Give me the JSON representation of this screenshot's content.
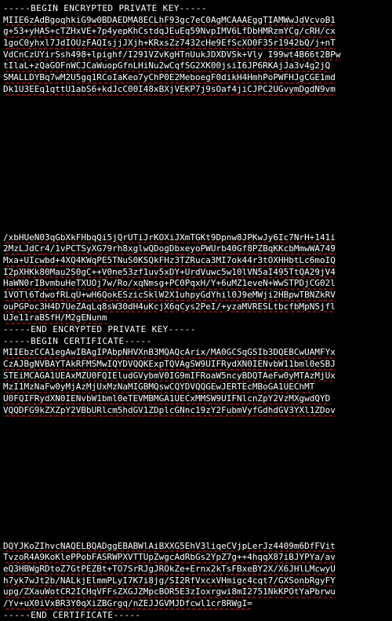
{
  "colors": {
    "background": "#000000",
    "text": "#ffffff",
    "spellcheck_underline": "#d11d1d"
  },
  "terminal": {
    "key_begin": "-----BEGIN ENCRYPTED PRIVATE KEY-----",
    "key_top": [
      "MIIE6zAdBgoqhkiG9w0BDAEDMA8ECLhF93gc7eC0AgMCAAAEggTIAMWwJdVcvoB1",
      "g+53+yHAS+cTZHxVE+7p4yepKhCstdqJEuEq59NvpIMV6LfDbHMRzmYCg/cRH/cx",
      "1goC0yhxl7JdIOUzFAQIsjjJXjh+KRxsZz7432cHe9EfScXO0F35r1942bQ/j+nT",
      "VdCnCzUYirSsh498+lpighf/I291VZvKgHTnUukJDXDVSk+Vly I99wt4B66t2BPw",
      "tIlaL+zQaGOFnWCJCaWuopGfnLHiNu2wCqfSG2XK00jsiI6JP6RKAjJa3v4g2jQ",
      "SMALLDYBq7wM2U5gq1RCoIaKeo7yChP0E2MeboegF0dikH4HmhPoPWFHJgCGE1md",
      "Dk1U3EEq1qttU1abS6+kdJcC00I48xBXjVEKP7j9sOaf4jiCJPC2UGvymDgdN9vm"
    ],
    "key_bottom": [
      "/xbHUeN03qGbXkFHbqQi5jQrUTiJrKOXiJXmTGKt9Dpnw8JPKwJy6Ic7NrH+141i",
      "2MzLJdCr4/1vPCTSyXG79rh8xglwQDogDbxeyoPWUrb40Gf8PZBqKKcbMmwWA749",
      "Mxa+UIcwbd+4XQ4KWqPE5TNuS0KSQkFHz3TZRuca3MI7ok44r3tOXHHbtLc6moIQ",
      "I2pXHKk80Mau2S0gC++V0ne53zf1uv5xDY+UrdVuwc5w10lVN5aI495TtQA29jV4",
      "HaWN0rIBvmbuHeTXUOj7w/Ro/xqNmsg+PC0PqxH/Y+6uMZ1eveN+WwSTPDjCG02l",
      "1VOTl6TdwofRLqU+wH6QokESzicSklW2X1uhpyGdYhil0J9eMWji2HBpwTBNZkRV",
      "ouPGPoc3H4D7UeZAqLq8sW30dH4uKcjX6qCys2PeI/+yzaMVRESLtbcfbMpNSjfl",
      "UJe11raBSfH/M2gENunm"
    ],
    "key_end": "-----END ENCRYPTED PRIVATE KEY-----",
    "cert_begin": "-----BEGIN CERTIFICATE-----",
    "cert_top": [
      "MIIEbzCCA1egAwIBAgIPAbpNHVXnB3MQAQcArix/MA0GCSqGSIb3DQEBCwUAMFYx",
      "CzAJBgNVBAYTAkRFMSMwIQYDVQQKExpTQVAgSW9UIFRydXN0IENvbW11bml0eSBJ",
      "STEiMCAGA1UEAxMZU0FQIEludGVybmV0IG9mIFRoaW5ncyBDQTAeFw0yMTAzMjUx",
      "MzI1MzNaFw0yMjAzMjUxMzNaMIGBMQswCQYDVQQGEwJERTEcMBoGA1UEChMT",
      "U0FQIFRydXN0IENvbW1bml0eTEVMBMGA1UECxMMSW9UIFNlcnZpY2VzMXgwdQYD",
      "VQQDFG9kZXZpY2VBbURlcm5hdGV1ZDplcGNnc19zY2FubmVyfGdhdGV3YXl1ZDov"
    ],
    "cert_bottom": [
      "DQYJKoZIhvcNAQELBQADggEBABWlAiBXXG5EhV3liqeCVjpLerJz4409m6DfFVit",
      "TvzoR4A9KoKlePPobFASRWPXVTTUpZwgcAdRbGs2YpZ7g++4hqqX87iBJYPYa/av",
      "eQ3HBWgRDtoZ7GtPEZBt+TO7SrRJgJROkZe+Ernx2kTsFBxeBY2X/X6JHlLMcwyU",
      "h7yk7wJt2b/NALkjElmmPLyI7K7i8jg/SI2RfVxcxVHmigc4cqt7/GXSonbRgyFY",
      "upg/ZXauWotCR2ICHqVFFsZXGJZMpcBOR5E3zIoxrgwi8mI2751NkKPOtYaPbrwu",
      "/Yv+uX0iVxBR3Y0qXiZBGrgq/nZEJJGVMJDfcwl1cr8RWgI="
    ],
    "cert_end": "-----END CERTIFICATE-----"
  }
}
